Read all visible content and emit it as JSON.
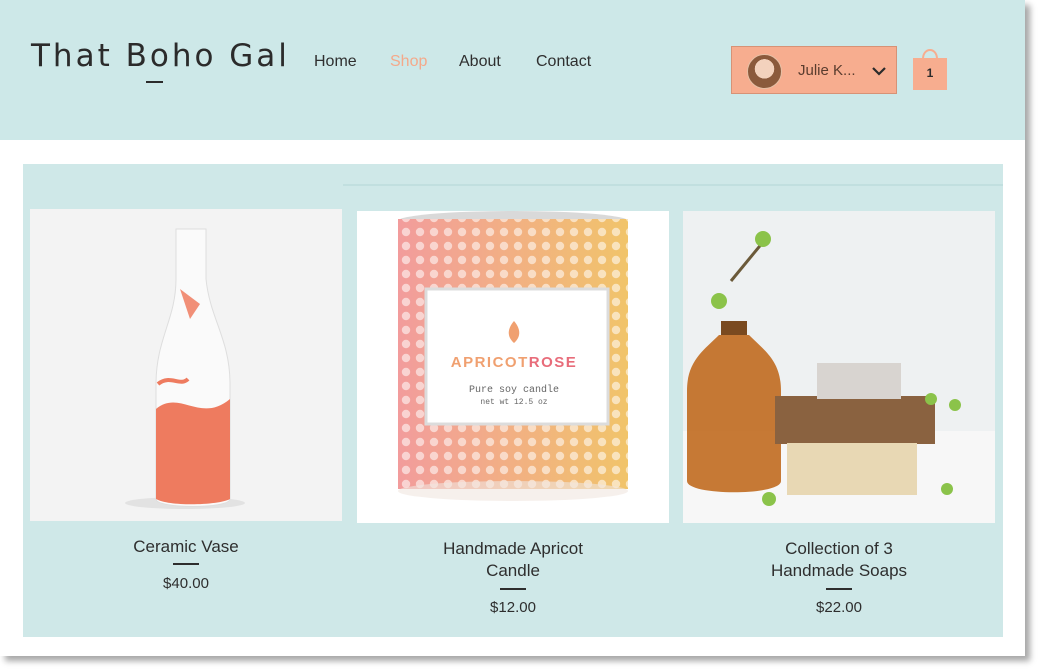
{
  "site": {
    "logo": "That Boho Gal",
    "nav": [
      {
        "label": "Home",
        "active": false
      },
      {
        "label": "Shop",
        "active": true
      },
      {
        "label": "About",
        "active": false
      },
      {
        "label": "Contact",
        "active": false
      }
    ],
    "user": {
      "name": "Julie K..."
    },
    "cart": {
      "count": "1"
    }
  },
  "products": [
    {
      "title_line1": "Ceramic Vase",
      "title_line2": "",
      "price": "$40.00"
    },
    {
      "title_line1": "Handmade Apricot",
      "title_line2": "Candle",
      "price": "$12.00"
    },
    {
      "title_line1": "Collection of 3",
      "title_line2": "Handmade Soaps",
      "price": "$22.00"
    }
  ],
  "candle_label": {
    "brand_a": "APRICOT",
    "brand_b": "ROSE",
    "line1": "Pure soy candle",
    "line2": "net wt 12.5 oz"
  },
  "colors": {
    "header_bg": "#cde8e8",
    "accent": "#f7ad8f",
    "gallery_bg": "#cfe8e8",
    "text": "#2e2e2e"
  },
  "icons": [
    "avatar",
    "chevron-down-icon",
    "shopping-bag-icon"
  ]
}
